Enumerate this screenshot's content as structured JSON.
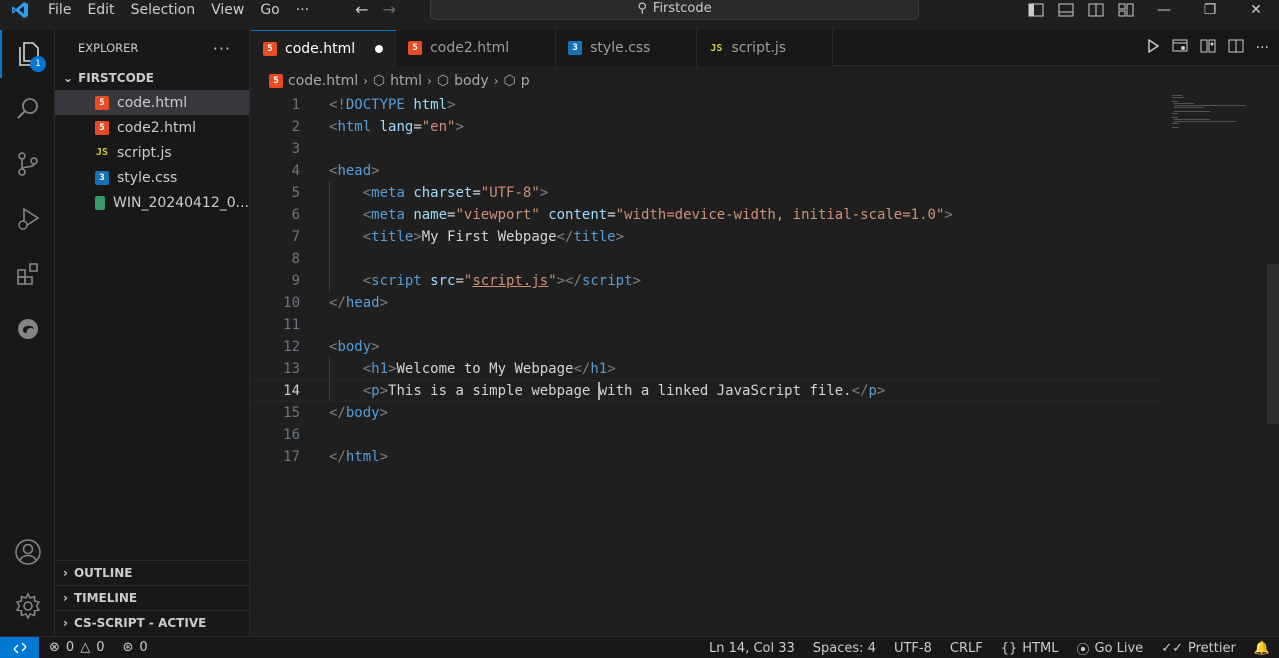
{
  "menu": [
    "File",
    "Edit",
    "Selection",
    "View",
    "Go"
  ],
  "menu_more": "···",
  "command_center": {
    "label": "Firstcode"
  },
  "explorer": {
    "title": "EXPLORER",
    "more": "···",
    "folder": "FIRSTCODE",
    "files": [
      {
        "name": "code.html",
        "type": "html",
        "selected": true
      },
      {
        "name": "code2.html",
        "type": "html",
        "selected": false
      },
      {
        "name": "script.js",
        "type": "js",
        "selected": false
      },
      {
        "name": "style.css",
        "type": "css",
        "selected": false
      },
      {
        "name": "WIN_20240412_0...",
        "type": "img",
        "selected": false
      }
    ],
    "sections": [
      "OUTLINE",
      "TIMELINE",
      "CS-SCRIPT - ACTIVE"
    ]
  },
  "activity_badge": "1",
  "tabs": [
    {
      "name": "code.html",
      "type": "html",
      "active": true,
      "modified": true
    },
    {
      "name": "code2.html",
      "type": "html",
      "active": false,
      "modified": false
    },
    {
      "name": "style.css",
      "type": "css",
      "active": false,
      "modified": false
    },
    {
      "name": "script.js",
      "type": "js",
      "active": false,
      "modified": false
    }
  ],
  "breadcrumb": [
    "code.html",
    "html",
    "body",
    "p"
  ],
  "code_lines": [
    {
      "n": "1",
      "tokens": [
        [
          "p",
          "<!"
        ],
        [
          "tag",
          "DOCTYPE"
        ],
        [
          "t",
          " "
        ],
        [
          "attr",
          "html"
        ],
        [
          "p",
          ">"
        ]
      ]
    },
    {
      "n": "2",
      "tokens": [
        [
          "p",
          "<"
        ],
        [
          "tag",
          "html"
        ],
        [
          "t",
          " "
        ],
        [
          "attr",
          "lang"
        ],
        [
          "t",
          "="
        ],
        [
          "str",
          "\"en\""
        ],
        [
          "p",
          ">"
        ]
      ]
    },
    {
      "n": "3",
      "tokens": []
    },
    {
      "n": "4",
      "tokens": [
        [
          "p",
          "<"
        ],
        [
          "tag",
          "head"
        ],
        [
          "p",
          ">"
        ]
      ]
    },
    {
      "n": "5",
      "tokens": [
        [
          "t",
          "    "
        ],
        [
          "p",
          "<"
        ],
        [
          "tag",
          "meta"
        ],
        [
          "t",
          " "
        ],
        [
          "attr",
          "charset"
        ],
        [
          "t",
          "="
        ],
        [
          "str",
          "\"UTF-8\""
        ],
        [
          "p",
          ">"
        ]
      ]
    },
    {
      "n": "6",
      "tokens": [
        [
          "t",
          "    "
        ],
        [
          "p",
          "<"
        ],
        [
          "tag",
          "meta"
        ],
        [
          "t",
          " "
        ],
        [
          "attr",
          "name"
        ],
        [
          "t",
          "="
        ],
        [
          "str",
          "\"viewport\""
        ],
        [
          "t",
          " "
        ],
        [
          "attr",
          "content"
        ],
        [
          "t",
          "="
        ],
        [
          "str",
          "\"width=device-width, initial-scale=1.0\""
        ],
        [
          "p",
          ">"
        ]
      ]
    },
    {
      "n": "7",
      "tokens": [
        [
          "t",
          "    "
        ],
        [
          "p",
          "<"
        ],
        [
          "tag",
          "title"
        ],
        [
          "p",
          ">"
        ],
        [
          "t",
          "My First Webpage"
        ],
        [
          "p",
          "</"
        ],
        [
          "tag",
          "title"
        ],
        [
          "p",
          ">"
        ]
      ]
    },
    {
      "n": "8",
      "tokens": []
    },
    {
      "n": "9",
      "tokens": [
        [
          "t",
          "    "
        ],
        [
          "p",
          "<"
        ],
        [
          "tag",
          "script"
        ],
        [
          "t",
          " "
        ],
        [
          "attr",
          "src"
        ],
        [
          "t",
          "="
        ],
        [
          "str",
          "\""
        ],
        [
          "strl",
          "script.js"
        ],
        [
          "str",
          "\""
        ],
        [
          "p",
          "></"
        ],
        [
          "tag",
          "script"
        ],
        [
          "p",
          ">"
        ]
      ]
    },
    {
      "n": "10",
      "tokens": [
        [
          "p",
          "</"
        ],
        [
          "tag",
          "head"
        ],
        [
          "p",
          ">"
        ]
      ]
    },
    {
      "n": "11",
      "tokens": []
    },
    {
      "n": "12",
      "tokens": [
        [
          "p",
          "<"
        ],
        [
          "tag",
          "body"
        ],
        [
          "p",
          ">"
        ]
      ]
    },
    {
      "n": "13",
      "tokens": [
        [
          "t",
          "    "
        ],
        [
          "p",
          "<"
        ],
        [
          "tag",
          "h1"
        ],
        [
          "p",
          ">"
        ],
        [
          "t",
          "Welcome to My Webpage"
        ],
        [
          "p",
          "</"
        ],
        [
          "tag",
          "h1"
        ],
        [
          "p",
          ">"
        ]
      ]
    },
    {
      "n": "14",
      "tokens": [
        [
          "t",
          "    "
        ],
        [
          "p",
          "<"
        ],
        [
          "tag",
          "p"
        ],
        [
          "p",
          ">"
        ],
        [
          "t",
          "This is a simple webpage "
        ],
        [
          "cursor",
          ""
        ],
        [
          "t",
          "with a linked JavaScript file."
        ],
        [
          "p",
          "</"
        ],
        [
          "tag",
          "p"
        ],
        [
          "p",
          ">"
        ]
      ]
    },
    {
      "n": "15",
      "tokens": [
        [
          "p",
          "</"
        ],
        [
          "tag",
          "body"
        ],
        [
          "p",
          ">"
        ]
      ]
    },
    {
      "n": "16",
      "tokens": []
    },
    {
      "n": "17",
      "tokens": [
        [
          "p",
          "</"
        ],
        [
          "tag",
          "html"
        ],
        [
          "p",
          ">"
        ]
      ]
    }
  ],
  "current_line": "14",
  "status": {
    "errors": "0",
    "warnings": "0",
    "ports": "0",
    "position": "Ln 14, Col 33",
    "spaces": "Spaces: 4",
    "encoding": "UTF-8",
    "eol": "CRLF",
    "language": "HTML",
    "golive": "Go Live",
    "prettier": "Prettier"
  },
  "colors": {
    "accent": "#0078d4",
    "tag": "#569cd6",
    "attr": "#9cdcfe",
    "string": "#ce9178"
  }
}
